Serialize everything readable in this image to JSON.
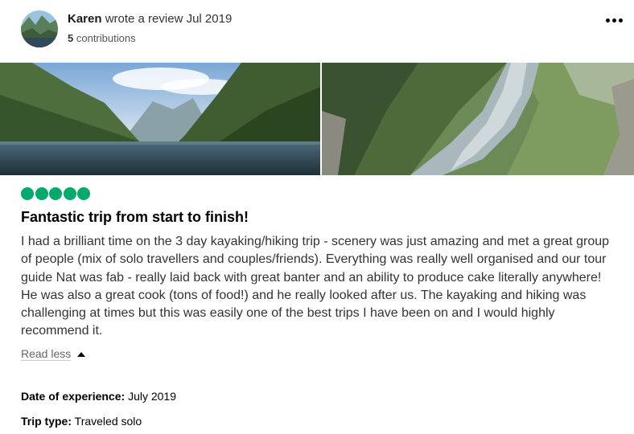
{
  "review": {
    "author": "Karen",
    "action": "wrote a review",
    "date": "Jul 2019",
    "contributions_count": "5",
    "contributions_label": "contributions",
    "rating": 5,
    "title": "Fantastic trip from start to finish!",
    "body": "I had a brilliant time on the 3 day kayaking/hiking trip - scenery was just amazing and met a great group of people (mix of solo travellers and couples/friends). Everything was really well organised and our tour guide Nat was fab - really laid back with great banter and an ability to produce cake literally anywhere! He was also a great cook (tons of food!) and he really looked after us. The kayaking and hiking was challenging at times but this was easily one of the best trips I have been on and I would highly recommend it.",
    "read_less": "Read less",
    "date_of_experience_label": "Date of experience:",
    "date_of_experience": "July 2019",
    "trip_type_label": "Trip type:",
    "trip_type": "Traveled solo"
  },
  "icons": {
    "more": "more-options-icon",
    "read_less_caret": "caret-up-icon",
    "rating": "rating-bubble-icon"
  },
  "colors": {
    "rating_bubble": "#00aa6c",
    "text": "#333333"
  }
}
